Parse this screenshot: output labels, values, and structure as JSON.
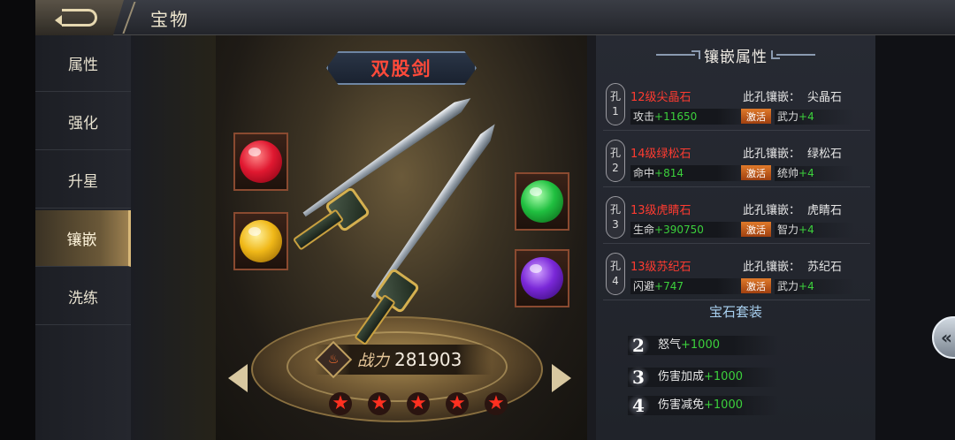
{
  "header": {
    "title": "宝物"
  },
  "sidebar": {
    "items": [
      {
        "label": "属性"
      },
      {
        "label": "强化"
      },
      {
        "label": "升星"
      },
      {
        "label": "镶嵌"
      },
      {
        "label": "洗练"
      }
    ],
    "active_index": 3
  },
  "treasure": {
    "name": "双股剑",
    "power_label": "战力",
    "power_value": "281903",
    "stars": 5,
    "gems_left": [
      "red-gem",
      "yellow-gem"
    ],
    "gems_right": [
      "green-gem",
      "purple-gem"
    ]
  },
  "panel": {
    "title": "镶嵌属性",
    "inlay_prefix": "此孔镶嵌：",
    "active_label": "激活",
    "holes": [
      {
        "tag_top": "孔",
        "tag_num": "1",
        "gem_name": "12级尖晶石",
        "stat_name": "攻击",
        "stat_value": "+11650",
        "inlaid": "尖晶石",
        "attr_name": "武力",
        "attr_value": "+4"
      },
      {
        "tag_top": "孔",
        "tag_num": "2",
        "gem_name": "14级绿松石",
        "stat_name": "命中",
        "stat_value": "+814",
        "inlaid": "绿松石",
        "attr_name": "统帅",
        "attr_value": "+4"
      },
      {
        "tag_top": "孔",
        "tag_num": "3",
        "gem_name": "13级虎睛石",
        "stat_name": "生命",
        "stat_value": "+390750",
        "inlaid": "虎睛石",
        "attr_name": "智力",
        "attr_value": "+4"
      },
      {
        "tag_top": "孔",
        "tag_num": "4",
        "gem_name": "13级苏纪石",
        "stat_name": "闪避",
        "stat_value": "+747",
        "inlaid": "苏纪石",
        "attr_name": "武力",
        "attr_value": "+4"
      }
    ],
    "set_title": "宝石套装",
    "set_bonuses": [
      {
        "num": "2",
        "name": "怒气",
        "value": "+1000"
      },
      {
        "num": "3",
        "name": "伤害加成",
        "value": "+1000"
      },
      {
        "num": "4",
        "name": "伤害减免",
        "value": "+1000"
      }
    ]
  },
  "colors": {
    "gem_name": "#ff3b30",
    "bonus_value": "#3cd03c",
    "active_badge": "#e07a2a",
    "treasure_name": "#ff4a3a"
  }
}
